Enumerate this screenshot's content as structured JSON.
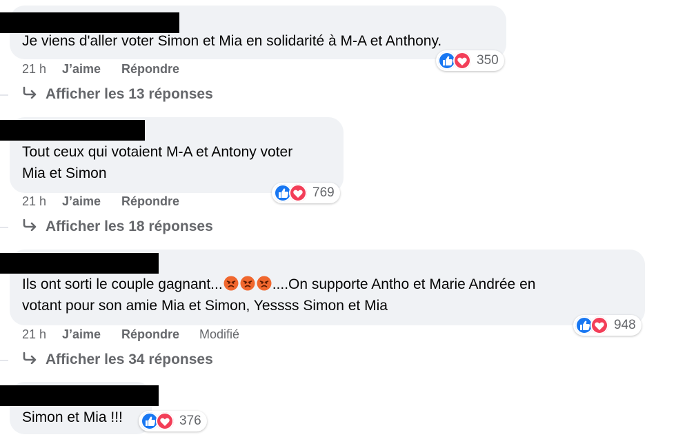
{
  "colors": {
    "bubble_bg": "#f0f2f5",
    "meta_text": "#65676b",
    "like_blue": "#1877f2",
    "love_red": "#f33e58",
    "angry_orange": "#f0672e"
  },
  "comments": [
    {
      "text": "Je viens d'aller voter Simon et Mia en solidarité à M-A et Anthony.",
      "time": "21 h",
      "like_label": "J’aime",
      "reply_label": "Répondre",
      "reaction_count": "350",
      "replies_label": "Afficher les 13 réponses"
    },
    {
      "text_line1": "Tout ceux qui votaient M-A et Antony voter",
      "text_line2": "Mia et Simon",
      "time": "21 h",
      "like_label": "J’aime",
      "reply_label": "Répondre",
      "reaction_count": "769",
      "replies_label": "Afficher les 18 réponses"
    },
    {
      "text_part1": "Ils ont sorti le couple gagnant...",
      "text_part2": "....On supporte Antho et Marie Andrée en",
      "text_line2": "votant pour son amie Mia et Simon, Yessss Simon et Mia",
      "emojis": [
        "angry-face-icon",
        "angry-face-icon",
        "angry-face-icon"
      ],
      "time": "21 h",
      "like_label": "J’aime",
      "reply_label": "Répondre",
      "edited_label": "Modifié",
      "reaction_count": "948",
      "replies_label": "Afficher les 34 réponses"
    },
    {
      "text": "Simon et Mia !!!",
      "reaction_count": "376"
    }
  ]
}
